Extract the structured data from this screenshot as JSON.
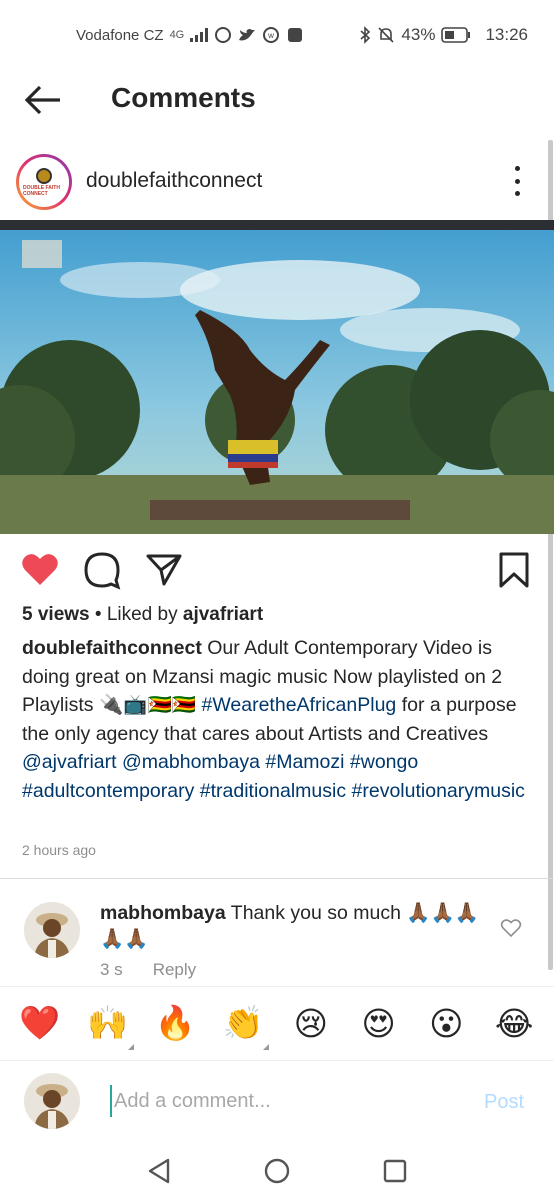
{
  "status_bar": {
    "carrier": "Vodafone CZ",
    "network": "4G",
    "battery": "43%",
    "time": "13:26"
  },
  "header": {
    "title": "Comments"
  },
  "post": {
    "username": "doublefaithconnect",
    "avatar_logo_text": "DOUBLE FAITH CONNECT",
    "views": "5 views",
    "liked_by_prefix": "Liked by",
    "liked_by_user": "ajvafriart",
    "caption": {
      "username": "doublefaithconnect",
      "text_1": "Our Adult Contemporary Video is doing great on Mzansi magic music Now playlisted on 2 Playlists",
      "emojis": "🔌📺🇿🇼🇿🇼",
      "hashtag_1": "#WearetheAfricanPlug",
      "text_2": "for a purpose the only agency that cares about Artists and Creatives",
      "mention_1": "@ajvafriart",
      "mention_2": "@mabhombaya",
      "hashtag_2": "#Mamozi",
      "hashtag_3": "#wongo",
      "hashtag_4": "#adultcontemporary",
      "hashtag_5": "#traditionalmusic",
      "hashtag_6": "#revolutionarymusic"
    },
    "time_ago": "2 hours ago",
    "liked": true
  },
  "comments": [
    {
      "username": "mabhombaya",
      "text": "Thank you so much 🙏🏾🙏🏾🙏🏾🙏🏾🙏🏾",
      "age": "3 s",
      "reply_label": "Reply"
    }
  ],
  "emoji_bar": [
    "❤️",
    "🙌",
    "🔥",
    "👏",
    "😢",
    "😍",
    "😮",
    "😂"
  ],
  "input": {
    "placeholder": "Add a comment...",
    "post_label": "Post"
  },
  "colors": {
    "like_red": "#ed4956",
    "link_blue": "#00376b",
    "post_disabled": "#b3dbff",
    "muted": "#8e8e8e"
  }
}
